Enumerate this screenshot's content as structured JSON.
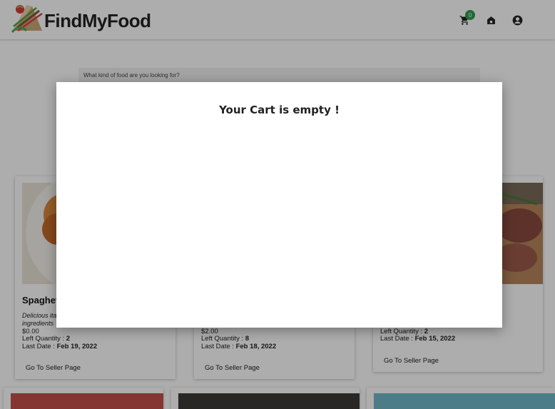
{
  "header": {
    "brand": "FindMyFood",
    "cart_count": "0",
    "icons": [
      "cart-icon",
      "home-icon",
      "account-icon"
    ]
  },
  "search": {
    "label": "What kind of food are you looking for?"
  },
  "cards": [
    {
      "title": "Spaghet",
      "description_lines": [
        "Delicious ita",
        "ingredients"
      ],
      "price": "$0.00",
      "left_quantity_label": "Left Quantity :",
      "left_quantity": "2",
      "last_date_label": "Last Date :",
      "last_date": "Feb 19, 2022",
      "button": "Go To Seller Page"
    },
    {
      "title": "",
      "price": "$2.00",
      "left_quantity_label": "Left Quantity :",
      "left_quantity": "8",
      "last_date_label": "Last Date :",
      "last_date": "Feb 18, 2022",
      "button": "Go To Seller Page"
    },
    {
      "title": "",
      "left_quantity_label": "Left Quantity :",
      "left_quantity": "2",
      "last_date_label": "Last Date :",
      "last_date": "Feb 15, 2022",
      "button": "Go To Seller Page"
    }
  ],
  "modal": {
    "title": "Your Cart is empty !"
  },
  "colors": {
    "badge": "#2e9e4f",
    "overlay": "rgba(0,0,0,0.32)"
  }
}
